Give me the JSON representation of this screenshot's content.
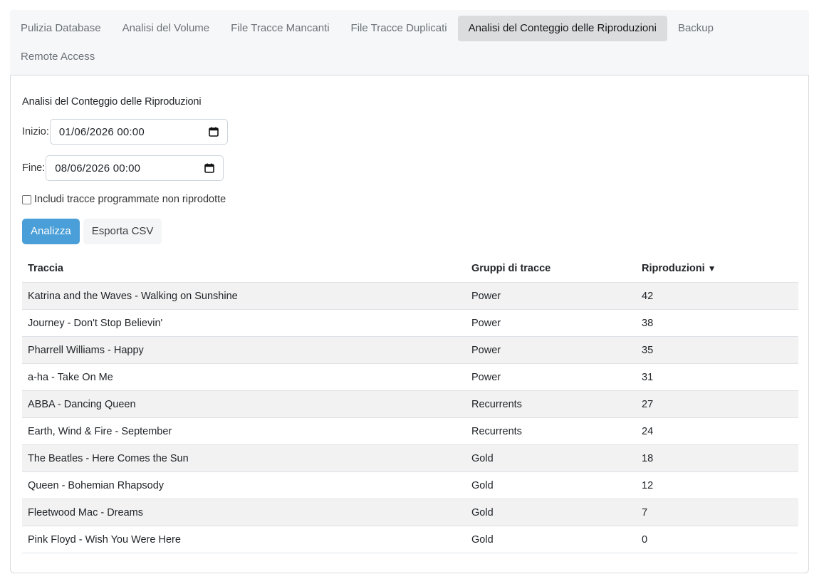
{
  "tabs": [
    {
      "label": "Pulizia Database",
      "active": false
    },
    {
      "label": "Analisi del Volume",
      "active": false
    },
    {
      "label": "File Tracce Mancanti",
      "active": false
    },
    {
      "label": "File Tracce Duplicati",
      "active": false
    },
    {
      "label": "Analisi del Conteggio delle Riproduzioni",
      "active": true
    },
    {
      "label": "Backup",
      "active": false
    },
    {
      "label": "Remote Access",
      "active": false
    }
  ],
  "panel": {
    "title": "Analisi del Conteggio delle Riproduzioni",
    "start": {
      "label": "Inizio:",
      "value": "01/06/2026 00:00",
      "icon": "calendar-icon"
    },
    "end": {
      "label": "Fine:",
      "value": "08/06/2026 00:00",
      "icon": "calendar-icon"
    },
    "include_unplayed": {
      "label": "Includi tracce programmate non riprodotte",
      "checked": false
    },
    "analyze_label": "Analizza",
    "export_label": "Esporta CSV"
  },
  "table": {
    "headers": {
      "track": "Traccia",
      "group": "Gruppi di tracce",
      "plays": "Riproduzioni",
      "sort_indicator": "▼"
    },
    "rows": [
      {
        "track": "Katrina and the Waves - Walking on Sunshine",
        "group": "Power",
        "plays": "42"
      },
      {
        "track": "Journey - Don't Stop Believin'",
        "group": "Power",
        "plays": "38"
      },
      {
        "track": "Pharrell Williams - Happy",
        "group": "Power",
        "plays": "35"
      },
      {
        "track": "a-ha - Take On Me",
        "group": "Power",
        "plays": "31"
      },
      {
        "track": "ABBA - Dancing Queen",
        "group": "Recurrents",
        "plays": "27"
      },
      {
        "track": "Earth, Wind & Fire - September",
        "group": "Recurrents",
        "plays": "24"
      },
      {
        "track": "The Beatles - Here Comes the Sun",
        "group": "Gold",
        "plays": "18"
      },
      {
        "track": "Queen - Bohemian Rhapsody",
        "group": "Gold",
        "plays": "12"
      },
      {
        "track": "Fleetwood Mac - Dreams",
        "group": "Gold",
        "plays": "7"
      },
      {
        "track": "Pink Floyd - Wish You Were Here",
        "group": "Gold",
        "plays": "0"
      }
    ]
  },
  "colors": {
    "primary": "#4a9fd8",
    "tab_active_bg": "#dadcde",
    "tabbar_bg": "#f6f7f8",
    "stripe": "#f2f2f2"
  }
}
